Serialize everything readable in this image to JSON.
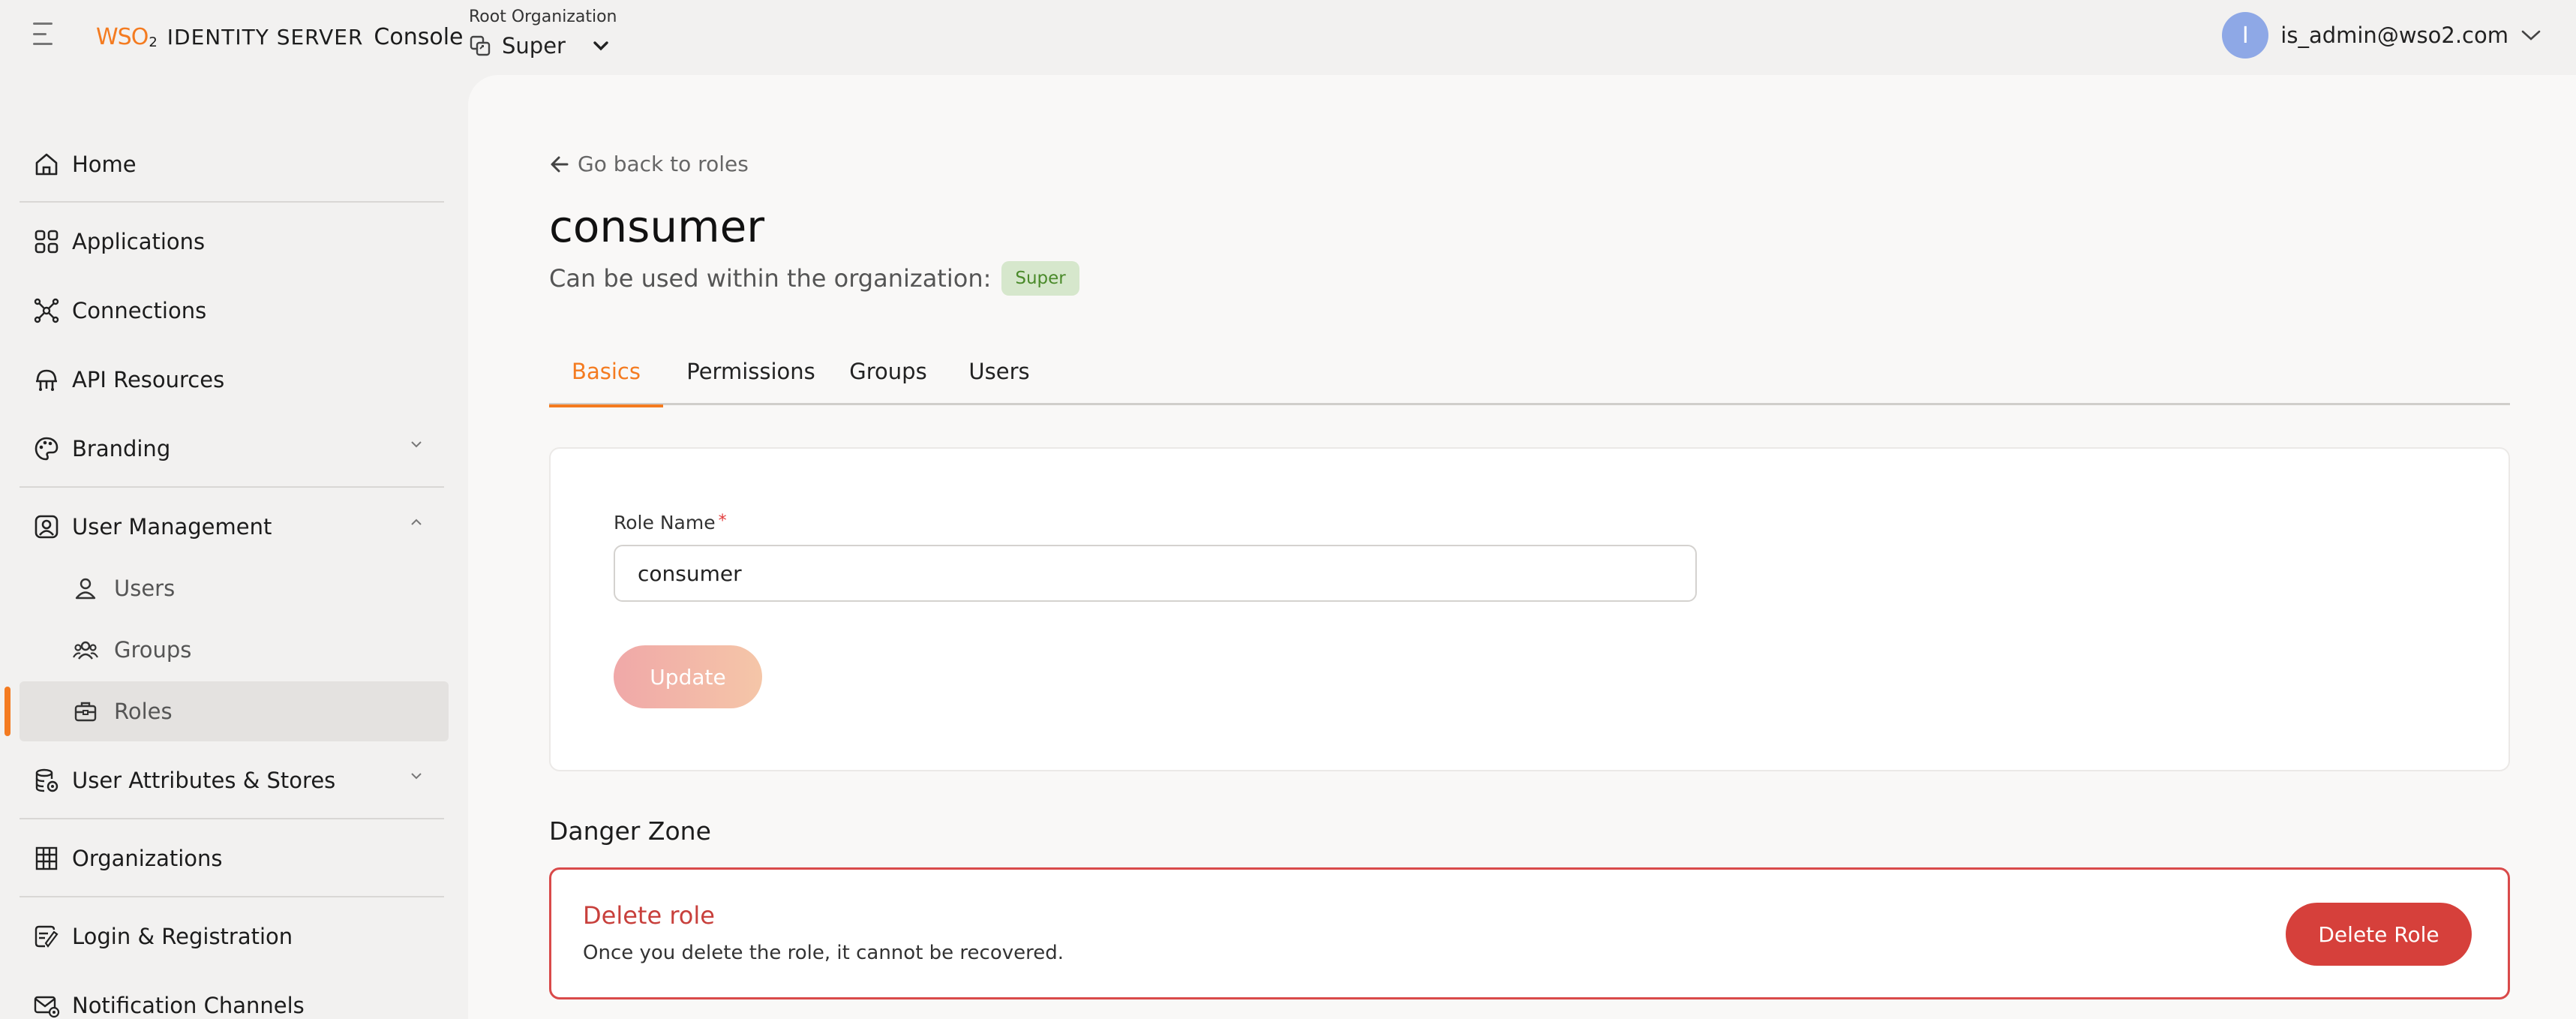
{
  "header": {
    "menu_icon": "hamburger-menu-icon",
    "logo_mark": "WSO",
    "logo_sub": "2",
    "product_name": "IDENTITY SERVER",
    "console_label": "Console",
    "org_label": "Root Organization",
    "org_name": "Super",
    "user_initial": "I",
    "user_email": "is_admin@wso2.com",
    "accent_color": "#f47b20"
  },
  "sidebar": {
    "items": [
      {
        "label": "Home",
        "icon": "home-icon"
      },
      {
        "label": "Applications",
        "icon": "applications-grid-icon"
      },
      {
        "label": "Connections",
        "icon": "connections-icon"
      },
      {
        "label": "API Resources",
        "icon": "api-resources-icon"
      },
      {
        "label": "Branding",
        "icon": "palette-icon",
        "expandable": true
      },
      {
        "label": "User Management",
        "icon": "user-management-icon",
        "expanded": true
      },
      {
        "label": "User Attributes & Stores",
        "icon": "database-icon",
        "expandable": true
      },
      {
        "label": "Organizations",
        "icon": "building-icon"
      },
      {
        "label": "Login & Registration",
        "icon": "login-icon"
      },
      {
        "label": "Notification Channels",
        "icon": "mail-icon"
      }
    ],
    "sub_items": [
      {
        "label": "Users",
        "icon": "user-icon"
      },
      {
        "label": "Groups",
        "icon": "groups-icon"
      },
      {
        "label": "Roles",
        "icon": "roles-icon",
        "active": true
      }
    ]
  },
  "main": {
    "back_label": "Go back to roles",
    "title": "consumer",
    "org_usage_label": "Can be used within the organization:",
    "org_badge": "Super",
    "tabs": [
      {
        "label": "Basics",
        "active": true
      },
      {
        "label": "Permissions"
      },
      {
        "label": "Groups"
      },
      {
        "label": "Users"
      }
    ],
    "form": {
      "role_name_label": "Role Name",
      "required_mark": "*",
      "role_name_value": "consumer",
      "update_label": "Update"
    },
    "danger_zone": {
      "title": "Danger Zone",
      "heading": "Delete role",
      "description": "Once you delete the role, it cannot be recovered.",
      "button_label": "Delete Role",
      "color": "#d6403b"
    }
  }
}
